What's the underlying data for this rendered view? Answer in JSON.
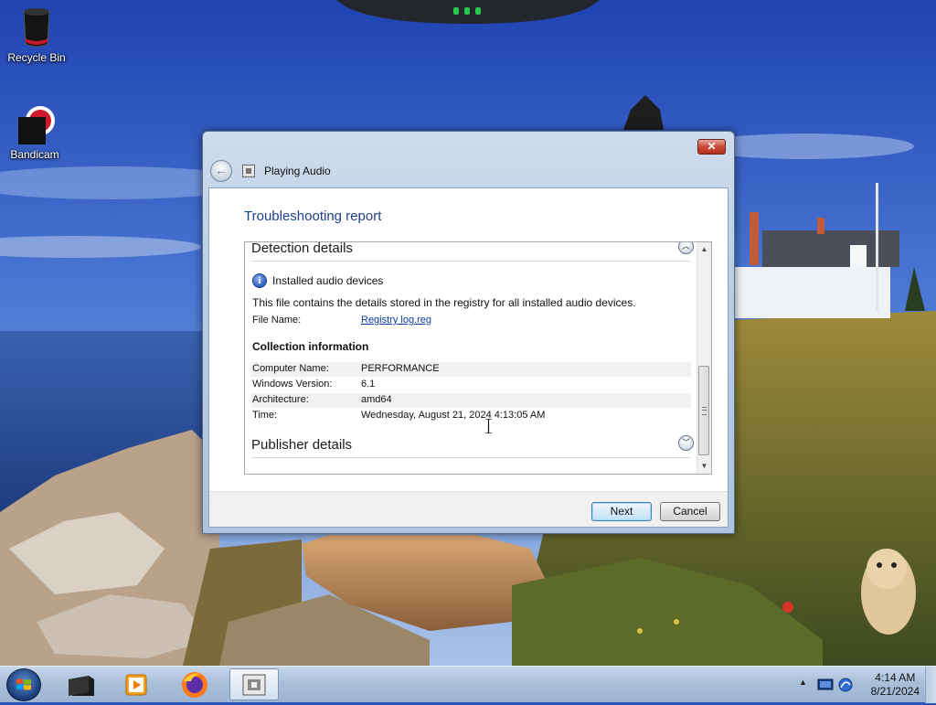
{
  "desktop": {
    "icons": [
      {
        "label": "Recycle Bin",
        "icon": "recycle-bin-icon"
      },
      {
        "label": "Bandicam",
        "icon": "bandicam-icon"
      }
    ]
  },
  "window": {
    "title": "Playing Audio",
    "close_symbol": "✕",
    "back_symbol": "←",
    "heading": "Troubleshooting report",
    "detection": {
      "title": "Detection details",
      "collapse_symbol": "︿",
      "item_title": "Installed audio devices",
      "item_icon": "info-icon",
      "description": "This file contains the details stored in the registry for all installed audio devices.",
      "file_name_label": "File Name:",
      "file_name_value": "Registry log.reg"
    },
    "collection": {
      "title": "Collection information",
      "rows": [
        {
          "label": "Computer Name:",
          "value": "PERFORMANCE"
        },
        {
          "label": "Windows Version:",
          "value": "6.1"
        },
        {
          "label": "Architecture:",
          "value": "amd64"
        },
        {
          "label": "Time:",
          "value": "Wednesday, August 21, 2024 4:13:05 AM"
        }
      ]
    },
    "publisher": {
      "title": "Publisher details",
      "expand_symbol": "﹀"
    },
    "scrollbar": {
      "up_symbol": "▲",
      "down_symbol": "▼"
    },
    "buttons": {
      "next": "Next",
      "cancel": "Cancel"
    }
  },
  "taskbar": {
    "apps": [
      {
        "icon": "explorer-folder-icon"
      },
      {
        "icon": "media-player-icon"
      },
      {
        "icon": "firefox-icon"
      },
      {
        "icon": "troubleshooter-icon",
        "active": true
      }
    ],
    "tray": {
      "expand_symbol": "▲",
      "time": "4:14 AM",
      "date": "8/21/2024"
    }
  },
  "colors": {
    "heading": "#1e3f8a",
    "link": "#0b3c9e",
    "close": "#c74a36"
  }
}
